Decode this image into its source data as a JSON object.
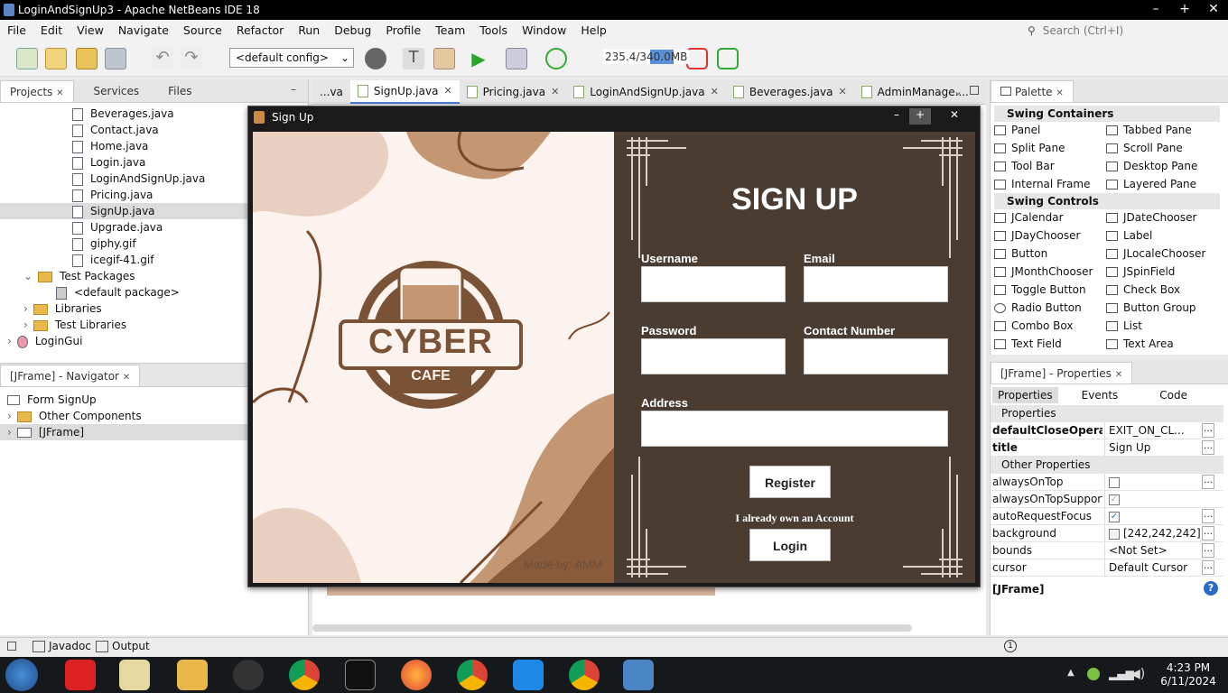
{
  "window": {
    "title": "LoginAndSignUp3 - Apache NetBeans IDE 18"
  },
  "menu": [
    "File",
    "Edit",
    "View",
    "Navigate",
    "Source",
    "Refactor",
    "Run",
    "Debug",
    "Profile",
    "Team",
    "Tools",
    "Window",
    "Help"
  ],
  "search": {
    "placeholder": "Search (Ctrl+I)"
  },
  "toolbar": {
    "config": "<default config>",
    "memory": "235.4/340.0MB"
  },
  "projects": {
    "tabs": [
      "Projects",
      "Services",
      "Files"
    ],
    "tree": [
      "Beverages.java",
      "Contact.java",
      "Home.java",
      "Login.java",
      "LoginAndSignUp.java",
      "Pricing.java",
      "SignUp.java",
      "Upgrade.java",
      "giphy.gif",
      "icegif-41.gif",
      "Test Packages",
      "<default package>",
      "Libraries",
      "Test Libraries",
      "LoginGui"
    ]
  },
  "navigator": {
    "title": "[JFrame] - Navigator",
    "items": [
      "Form SignUp",
      "Other Components",
      "[JFrame]"
    ]
  },
  "editor": {
    "tabs": [
      "...va",
      "SignUp.java",
      "Pricing.java",
      "LoginAndSignUp.java",
      "Beverages.java",
      "AdminManage...."
    ]
  },
  "signup_frame": {
    "title": "Sign Up",
    "logo_top": "CYBER",
    "logo_bottom": "CAFE",
    "credit": "Made by: AMM",
    "heading": "SIGN UP",
    "labels": {
      "username": "Username",
      "email": "Email",
      "password": "Password",
      "contact": "Contact Number",
      "address": "Address"
    },
    "register_label": "Register",
    "account_text": "I already own an Account",
    "login_label": "Login"
  },
  "palette": {
    "title": "Palette",
    "containers_label": "Swing Containers",
    "containers": [
      "Panel",
      "Tabbed Pane",
      "Split Pane",
      "Scroll Pane",
      "Tool Bar",
      "Desktop Pane",
      "Internal Frame",
      "Layered Pane"
    ],
    "controls_label": "Swing Controls",
    "controls": [
      "JCalendar",
      "JDateChooser",
      "JDayChooser",
      "Label",
      "Button",
      "JLocaleChooser",
      "JMonthChooser",
      "JSpinField",
      "Toggle Button",
      "Check Box",
      "Radio Button",
      "Button Group",
      "Combo Box",
      "List",
      "Text Field",
      "Text Area"
    ]
  },
  "properties": {
    "title": "[JFrame] - Properties",
    "tabs": [
      "Properties",
      "Events",
      "Code"
    ],
    "section1": "Properties",
    "rows1": [
      {
        "name": "defaultCloseOperation",
        "value": "EXIT_ON_CL..."
      },
      {
        "name": "title",
        "value": "Sign Up"
      }
    ],
    "section2": "Other Properties",
    "rows2": [
      {
        "name": "alwaysOnTop",
        "value": ""
      },
      {
        "name": "alwaysOnTopSupported",
        "value": ""
      },
      {
        "name": "autoRequestFocus",
        "value": ""
      },
      {
        "name": "background",
        "value": "[242,242,242]"
      },
      {
        "name": "bounds",
        "value": "<Not Set>"
      },
      {
        "name": "cursor",
        "value": "Default Cursor"
      }
    ],
    "footer": "[JFrame]"
  },
  "statusbar": {
    "javadoc": "Javadoc",
    "output": "Output"
  },
  "clock": {
    "time": "4:23 PM",
    "date": "6/11/2024"
  }
}
